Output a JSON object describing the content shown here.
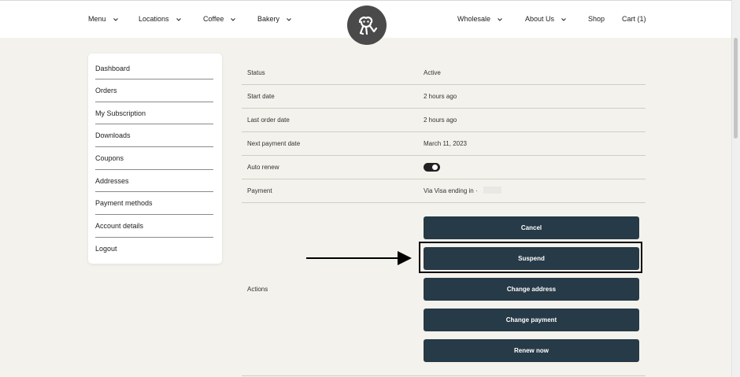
{
  "nav": {
    "left": [
      {
        "label": "Menu",
        "dropdown": true
      },
      {
        "label": "Locations",
        "dropdown": true
      },
      {
        "label": "Coffee",
        "dropdown": true
      },
      {
        "label": "Bakery",
        "dropdown": true
      }
    ],
    "right": [
      {
        "label": "Wholesale",
        "dropdown": true
      },
      {
        "label": "About Us",
        "dropdown": true
      },
      {
        "label": "Shop",
        "dropdown": false
      },
      {
        "label": "Cart (1)",
        "dropdown": false
      }
    ],
    "logo_icon": "monkey-logo-icon",
    "dropdown_icon": "chevron-down-icon"
  },
  "sidebar": {
    "items": [
      {
        "label": "Dashboard"
      },
      {
        "label": "Orders"
      },
      {
        "label": "My Subscription"
      },
      {
        "label": "Downloads"
      },
      {
        "label": "Coupons"
      },
      {
        "label": "Addresses"
      },
      {
        "label": "Payment methods"
      },
      {
        "label": "Account details"
      },
      {
        "label": "Logout"
      }
    ]
  },
  "subscription": {
    "rows": [
      {
        "label": "Status",
        "value": "Active"
      },
      {
        "label": "Start date",
        "value": "2 hours ago"
      },
      {
        "label": "Last order date",
        "value": "2 hours ago"
      },
      {
        "label": "Next payment date",
        "value": "March 11, 2023"
      },
      {
        "label": "Auto renew",
        "value": ""
      },
      {
        "label": "Payment",
        "value": "Via Visa ending in ·"
      }
    ],
    "auto_renew_on": true,
    "actions_label": "Actions",
    "actions": [
      {
        "label": "Cancel"
      },
      {
        "label": "Suspend"
      },
      {
        "label": "Change address"
      },
      {
        "label": "Change payment"
      },
      {
        "label": "Renew now"
      }
    ],
    "highlighted_action": "Suspend"
  },
  "colors": {
    "page_bg": "#f4f2ec",
    "button_bg": "#263a47",
    "logo_bg": "#4a4a4a"
  }
}
